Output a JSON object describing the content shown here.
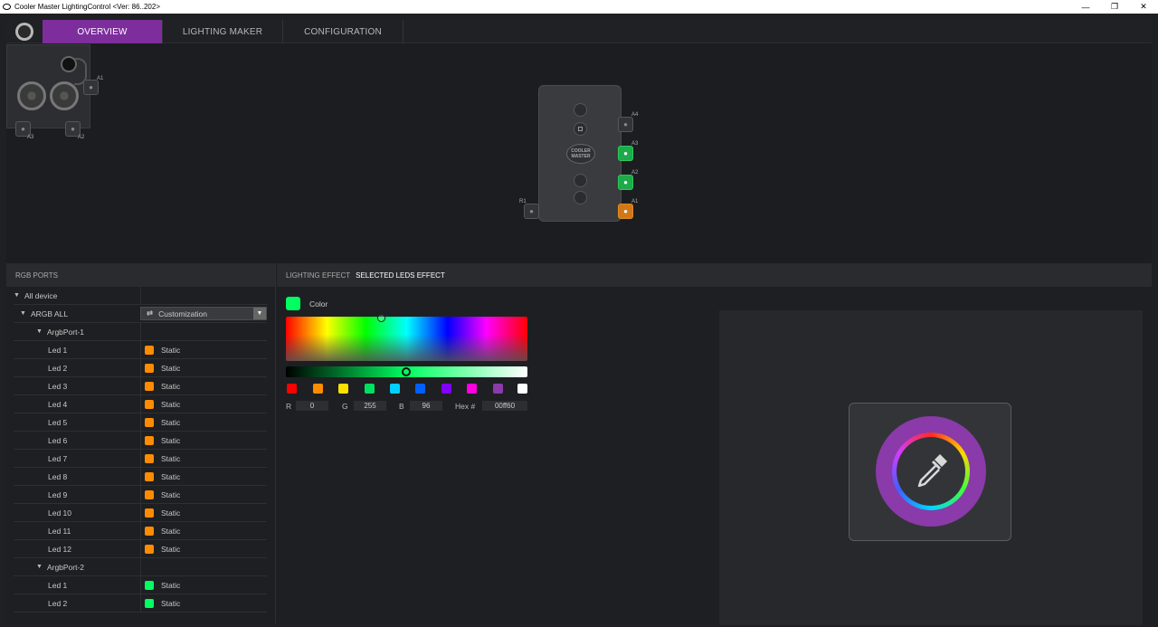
{
  "window": {
    "title": "Cooler Master LightingControl <Ver: 86..202>"
  },
  "nav": {
    "tabs": [
      {
        "label": "OVERVIEW",
        "active": true
      },
      {
        "label": "LIGHTING MAKER",
        "active": false
      },
      {
        "label": "CONFIGURATION",
        "active": false
      }
    ]
  },
  "device": {
    "mini_ports": {
      "a1": "A1",
      "a2": "A2",
      "a3": "A3"
    },
    "hub_logo": "COOLER MASTER",
    "hub_ports": {
      "a4": "A4",
      "a3": "A3",
      "a2": "A2",
      "a1": "A1",
      "r1": "R1"
    }
  },
  "rgb_ports": {
    "header": "RGB PORTS",
    "all_device": "All device",
    "argb_all": "ARGB ALL",
    "mode": "Customization",
    "ports": [
      {
        "name": "ArgbPort-1",
        "leds": [
          {
            "name": "Led 1",
            "effect": "Static",
            "color": "#ff8c00"
          },
          {
            "name": "Led 2",
            "effect": "Static",
            "color": "#ff8c00"
          },
          {
            "name": "Led 3",
            "effect": "Static",
            "color": "#ff8c00"
          },
          {
            "name": "Led 4",
            "effect": "Static",
            "color": "#ff8c00"
          },
          {
            "name": "Led 5",
            "effect": "Static",
            "color": "#ff8c00"
          },
          {
            "name": "Led 6",
            "effect": "Static",
            "color": "#ff8c00"
          },
          {
            "name": "Led 7",
            "effect": "Static",
            "color": "#ff8c00"
          },
          {
            "name": "Led 8",
            "effect": "Static",
            "color": "#ff8c00"
          },
          {
            "name": "Led 9",
            "effect": "Static",
            "color": "#ff8c00"
          },
          {
            "name": "Led 10",
            "effect": "Static",
            "color": "#ff8c00"
          },
          {
            "name": "Led 11",
            "effect": "Static",
            "color": "#ff8c00"
          },
          {
            "name": "Led 12",
            "effect": "Static",
            "color": "#ff8c00"
          }
        ]
      },
      {
        "name": "ArgbPort-2",
        "leds": [
          {
            "name": "Led 1",
            "effect": "Static",
            "color": "#00ff60"
          },
          {
            "name": "Led 2",
            "effect": "Static",
            "color": "#00ff60"
          }
        ]
      }
    ]
  },
  "effect_panel": {
    "label": "LIGHTING EFFECT",
    "selected": "SELECTED LEDS EFFECT",
    "color_label": "Color",
    "current_color": "#00ff60",
    "presets": [
      "#ff0000",
      "#ff8c00",
      "#ffe000",
      "#00e060",
      "#00d0ff",
      "#0060ff",
      "#8000ff",
      "#ff00e0",
      "#8a3aa9",
      "#ffffff"
    ],
    "r_label": "R",
    "r": "0",
    "g_label": "G",
    "g": "255",
    "b_label": "B",
    "b": "96",
    "hex_label": "Hex #",
    "hex": "00ff60"
  }
}
